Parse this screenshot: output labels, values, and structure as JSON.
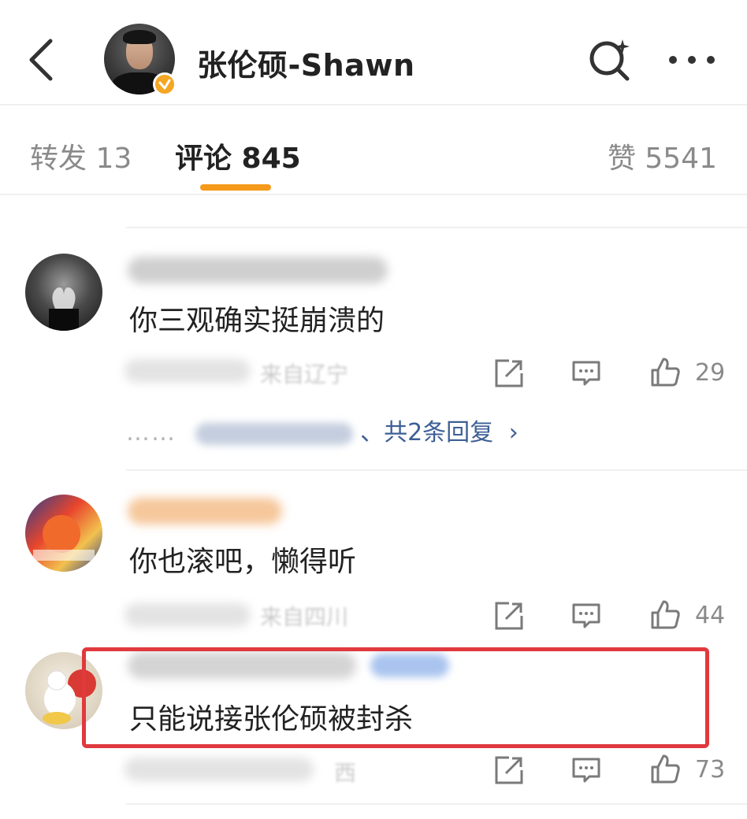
{
  "header": {
    "title": "张伦硕-Shawn"
  },
  "tabs": {
    "repost": "转发 13",
    "comment": "评论 845",
    "like": "赞 5541"
  },
  "colors": {
    "accent": "#f59a1a",
    "verify_badge": "#f5a623",
    "highlight_box": "#e0393e",
    "reply_link": "#3d5f95"
  },
  "comments": [
    {
      "text": "你三观确实挺崩溃的",
      "location": "来自辽宁",
      "likes": "29",
      "replies_label": "、共2条回复",
      "replies_chevron": "›",
      "ellipsis": "……"
    },
    {
      "text": "你也滚吧，懒得听",
      "location": "来自四川",
      "likes": "44"
    },
    {
      "text": "只能说接张伦硕被封杀",
      "location": "西",
      "likes": "73"
    }
  ]
}
